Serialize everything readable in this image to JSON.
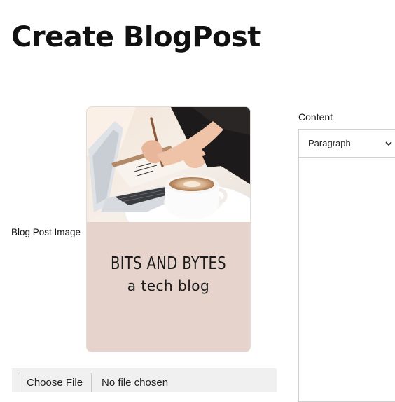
{
  "page": {
    "title": "Create BlogPost"
  },
  "image_field": {
    "label": "Blog Post Image",
    "preview": {
      "headline": "BITS AND BYTES",
      "tagline": "a tech blog",
      "background": "#e6d4cc"
    }
  },
  "file_input": {
    "button_label": "Choose File",
    "status": "No file chosen"
  },
  "content_field": {
    "label": "Content",
    "format_selected": "Paragraph",
    "dropdown_icon": "chevron-down-icon"
  }
}
